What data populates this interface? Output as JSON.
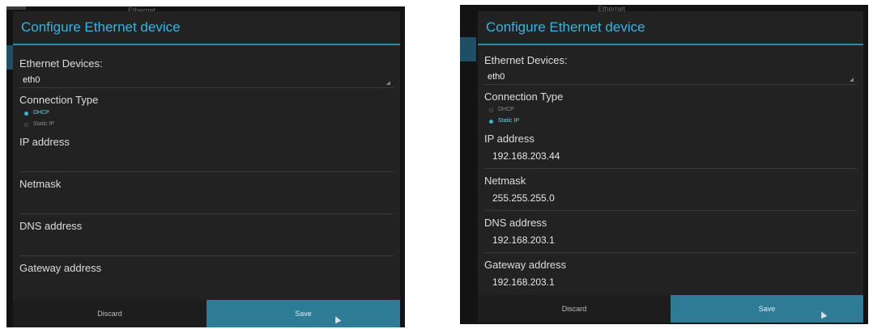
{
  "background_tab": "Ethernet",
  "dialog_title": "Configure Ethernet device",
  "ethernet_devices_label": "Ethernet Devices:",
  "device_value": "eth0",
  "connection_type_label": "Connection Type",
  "dhcp_label": "DHCP",
  "static_ip_label": "Static IP",
  "ip_label": "IP address",
  "netmask_label": "Netmask",
  "dns_label": "DNS address",
  "gateway_label": "Gateway address",
  "discard_label": "Discard",
  "save_label": "Save",
  "colors": {
    "accent": "#33b5e5",
    "save_button": "#2e7b96",
    "dialog_bg": "#222222"
  },
  "left": {
    "selected_connection": "DHCP",
    "ip_value": "",
    "netmask_value": "",
    "dns_value": "",
    "gateway_value": ""
  },
  "right": {
    "selected_connection": "Static IP",
    "ip_value": "192.168.203.44",
    "netmask_value": "255.255.255.0",
    "dns_value": "192.168.203.1",
    "gateway_value": "192.168.203.1"
  }
}
